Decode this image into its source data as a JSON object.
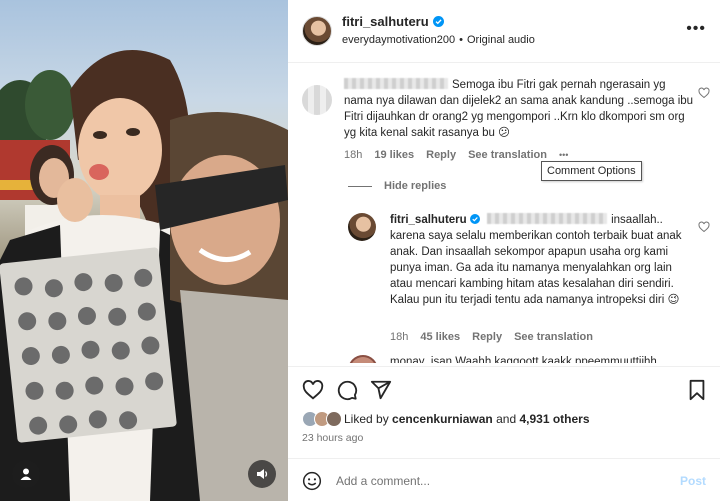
{
  "header": {
    "username": "fitri_salhuteru",
    "audio_user": "everydaymotivation200",
    "audio_label": "Original audio",
    "separator": "•"
  },
  "comments": [
    {
      "text": "Semoga ibu Fitri gak pernah ngerasain yg nama nya dilawan dan dijelek2 an sama anak kandung ..semoga ibu Fitri dijauhkan dr orang2 yg mengompori ..Krn klo dkompori sm org yg kita kenal sakit rasanya bu 😕",
      "time": "18h",
      "likes": "19 likes",
      "reply": "Reply",
      "translate": "See translation",
      "more": "•••",
      "tooltip": "Comment Options"
    }
  ],
  "hide_replies": "Hide replies",
  "reply": {
    "username": "fitri_salhuteru",
    "text": "insaallah.. karena saya selalu memberikan contoh terbaik buat anak anak. Dan insaallah sekompor apapun usaha org kami punya iman. Ga ada itu namanya menyalahkan org lain atau mencari kambing hitam atas kesalahan diri sendiri. Kalau pun itu terjadi tentu ada namanya intropeksi diri 😉",
    "time": "18h",
    "likes": "45 likes",
    "reply": "Reply",
    "translate": "See translation"
  },
  "next_comment": {
    "text": "monay_isan Waahh kaggoott kaakk ppeemmuuttiihh"
  },
  "likes_line": {
    "prefix": "Liked by",
    "user": "cencenkurniawan",
    "and": "and",
    "others": "4,931 others"
  },
  "time_ago": "23 hours ago",
  "add_comment": {
    "placeholder": "Add a comment...",
    "post": "Post"
  },
  "colors": {
    "verified": "#0095f6",
    "post_disabled": "#b3dbff",
    "secondary_text": "#737373"
  },
  "icons": [
    "heart-icon",
    "comment-icon",
    "share-icon",
    "bookmark-icon",
    "emoji-icon",
    "user-tag-icon",
    "audio-icon",
    "verified-icon",
    "more-icon"
  ]
}
